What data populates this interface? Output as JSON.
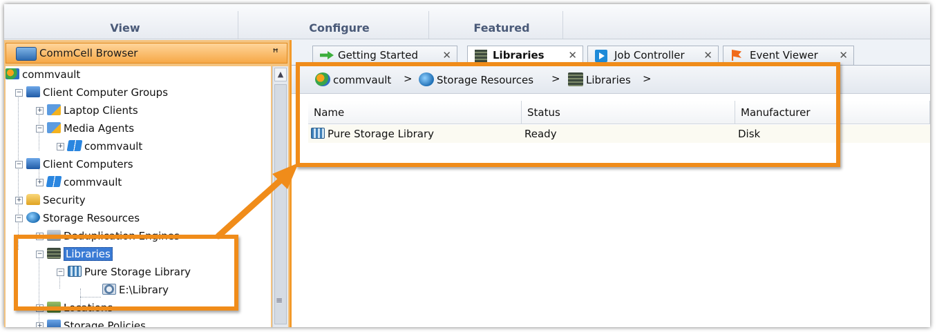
{
  "ribbon": {
    "tabs": [
      "View",
      "Configure",
      "Featured"
    ]
  },
  "left_panel": {
    "title": "CommCell Browser",
    "pin_glyph": "ꟸ",
    "tree": [
      {
        "label": "commvault",
        "icon": "commvault-logo-icon"
      },
      {
        "label": "Client Computer Groups",
        "icon": "computer-group-icon"
      },
      {
        "label": "Laptop Clients",
        "icon": "laptop-group-icon"
      },
      {
        "label": "Media Agents",
        "icon": "media-agent-group-icon"
      },
      {
        "label": "commvault",
        "icon": "windows-icon"
      },
      {
        "label": "Client Computers",
        "icon": "client-computers-icon"
      },
      {
        "label": "commvault",
        "icon": "windows-icon"
      },
      {
        "label": "Security",
        "icon": "lock-icon"
      },
      {
        "label": "Storage Resources",
        "icon": "globe-icon"
      },
      {
        "label": "Deduplication Engines",
        "icon": "dedup-icon"
      },
      {
        "label": "Libraries",
        "icon": "library-icon",
        "selected": true
      },
      {
        "label": "Pure Storage Library",
        "icon": "disk-library-icon"
      },
      {
        "label": "E:\\Library",
        "icon": "mount-path-icon"
      },
      {
        "label": "Locations",
        "icon": "locations-icon"
      },
      {
        "label": "Storage Policies",
        "icon": "storage-policy-icon"
      }
    ]
  },
  "tabs": [
    {
      "label": "Getting Started",
      "icon": "green-arrow-icon",
      "active": false
    },
    {
      "label": "Libraries",
      "icon": "library-icon",
      "active": true
    },
    {
      "label": "Job Controller",
      "icon": "play-icon",
      "active": false
    },
    {
      "label": "Event Viewer",
      "icon": "flag-icon",
      "active": false
    }
  ],
  "close_glyph": "✕",
  "breadcrumb": [
    {
      "label": "commvault",
      "icon": "commvault-logo-icon"
    },
    {
      "label": "Storage Resources",
      "icon": "globe-icon"
    },
    {
      "label": "Libraries",
      "icon": "library-icon"
    }
  ],
  "breadcrumb_separator": ">",
  "table": {
    "columns": [
      "Name",
      "Status",
      "Manufacturer"
    ],
    "rows": [
      {
        "name": "Pure Storage Library",
        "status": "Ready",
        "manufacturer": "Disk"
      }
    ]
  },
  "colors": {
    "accent_orange": "#f08c1a",
    "selection_blue": "#3a7bd5"
  }
}
